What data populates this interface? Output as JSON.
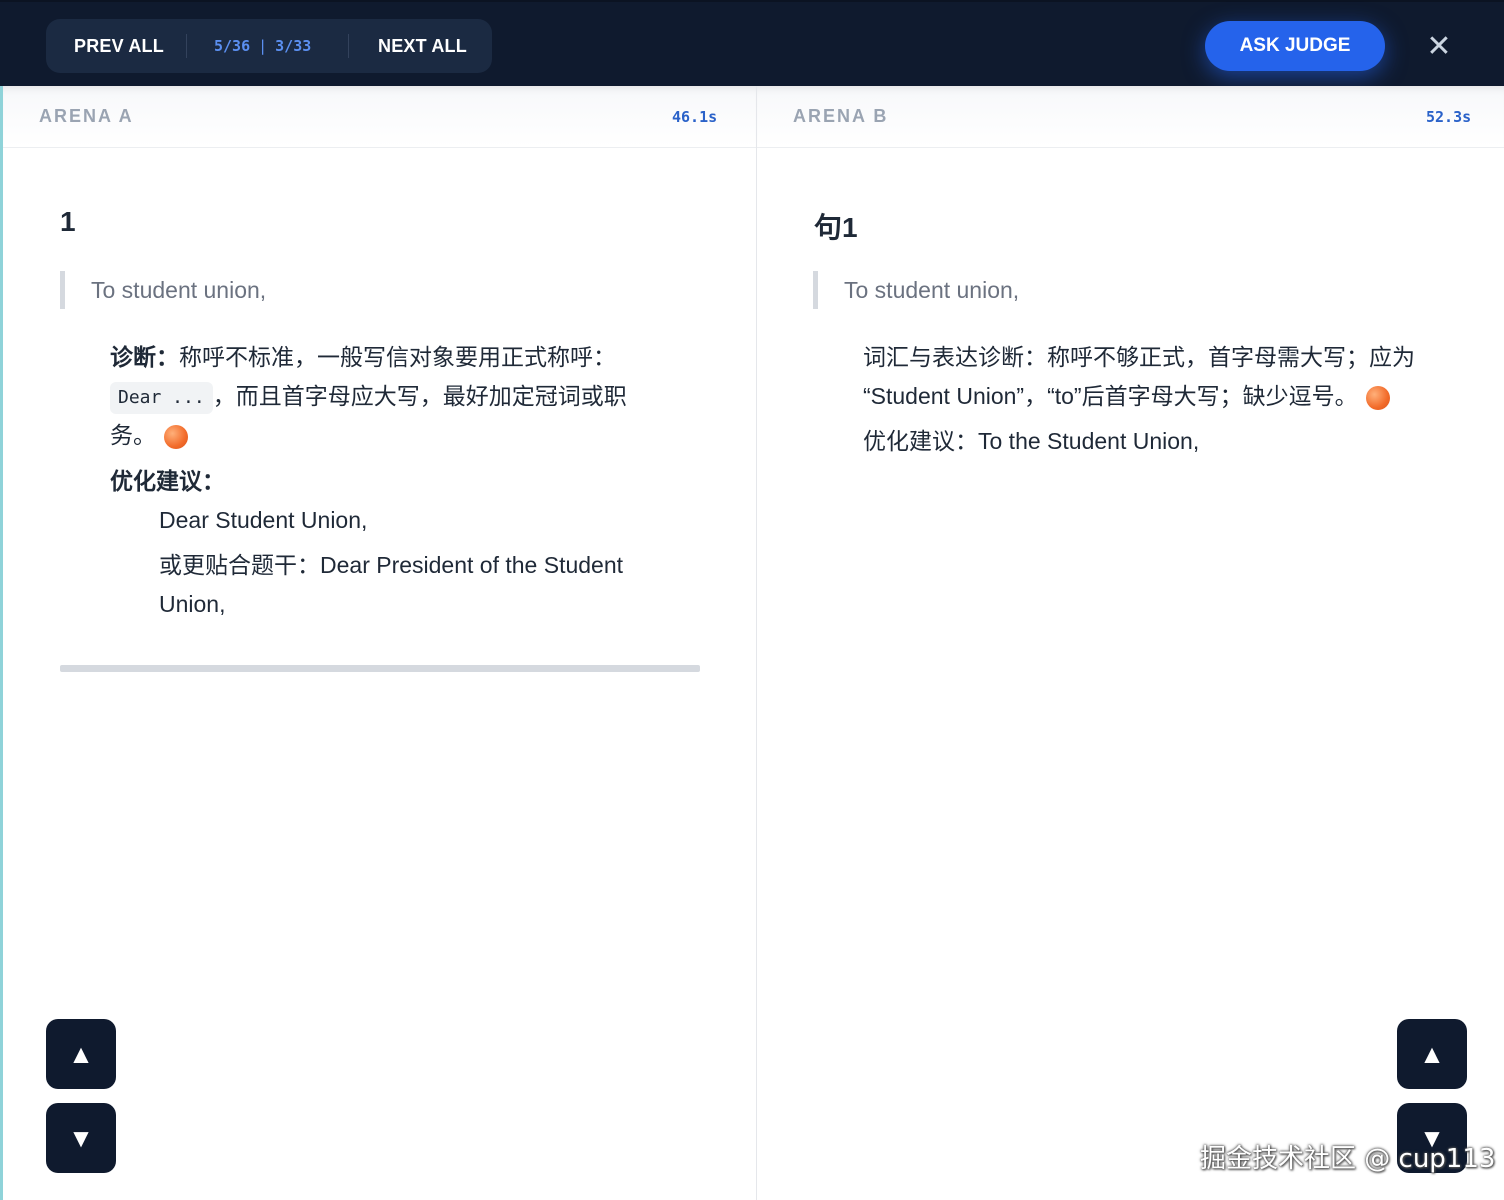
{
  "toolbar": {
    "prev_label": "PREV ALL",
    "next_label": "NEXT ALL",
    "count_a": "5/36",
    "count_sep": "|",
    "count_b": "3/33",
    "ask_judge_label": "ASK JUDGE",
    "close_glyph": "✕"
  },
  "arena_a": {
    "label": "ARENA A",
    "time": "46.1s",
    "title": "1",
    "quote": "To student union,",
    "diag_prefix": "诊断：",
    "diag_line1": "称呼不标准，一般写信对象要用正式称呼：",
    "diag_code": "Dear ...",
    "diag_line2": "，而且首字母应大写，最好加定冠词或职",
    "diag_line3": "务。",
    "suggest_label": "优化建议：",
    "suggest_1": "Dear Student Union,",
    "suggest_2a": "或更贴合题干：Dear President of the Student",
    "suggest_2b": "Union,"
  },
  "arena_b": {
    "label": "ARENA B",
    "time": "52.3s",
    "title": "句1",
    "quote": "To student union,",
    "diag_line1": "词汇与表达诊断：称呼不够正式，首字母需大写；应为",
    "diag_line2": "“Student Union”，“to”后首字母大写；缺少逗号。",
    "suggest": "优化建议：To the Student Union,"
  },
  "scroll": {
    "up_glyph": "▲",
    "down_glyph": "▼"
  },
  "watermark": "掘金技术社区 @ cup113",
  "icons": {
    "close": "close-icon",
    "up": "arrow-up-icon",
    "down": "arrow-down-icon",
    "status": "status-dot-icon"
  },
  "colors": {
    "topbar": "#0f1a2e",
    "accent": "#2563eb",
    "time_text": "#2a62c9",
    "status_dot": "#f26b2a"
  }
}
